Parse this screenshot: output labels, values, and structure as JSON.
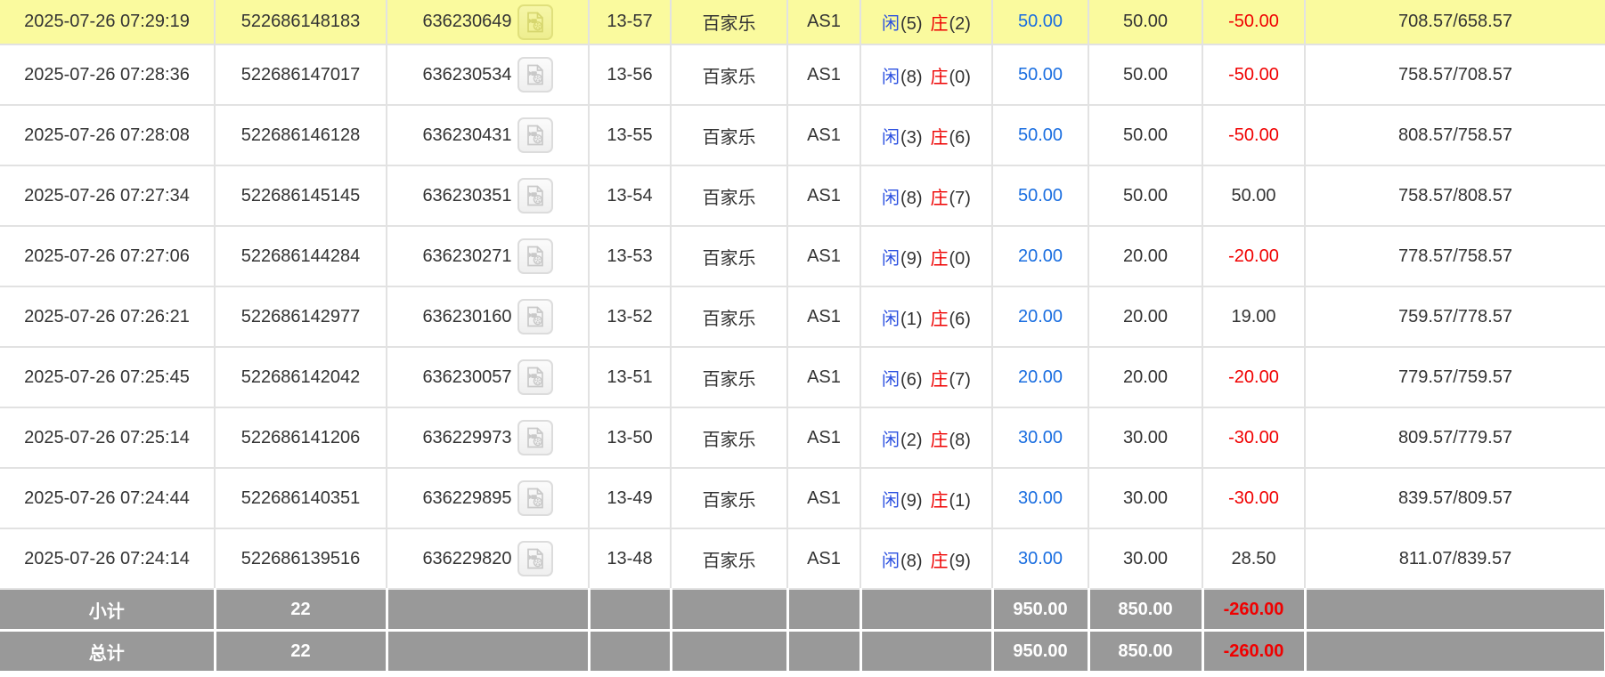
{
  "colors": {
    "highlight_row_bg": "#fafa9e",
    "summary_row_bg": "#999999",
    "grid_border": "#e2e2e2",
    "player_blue": "#2b50e0",
    "bet_amount_blue": "#1a6ee0",
    "banker_red": "#ee0000",
    "loss_red": "#f00000",
    "text": "#333333"
  },
  "icons": {
    "video_replay": "video-file-icon"
  },
  "table": {
    "rows": [
      {
        "time": "2025-07-26 07:29:19",
        "bet_id": "522686148183",
        "game_id": "636230649",
        "round": "13-57",
        "game": "百家乐",
        "table": "AS1",
        "player_label": "闲",
        "player_num": "(5)",
        "banker_label": "庄",
        "banker_num": "(2)",
        "bet": "50.00",
        "valid": "50.00",
        "winloss": "-50.00",
        "balance": "708.57/658.57",
        "highlighted": true
      },
      {
        "time": "2025-07-26 07:28:36",
        "bet_id": "522686147017",
        "game_id": "636230534",
        "round": "13-56",
        "game": "百家乐",
        "table": "AS1",
        "player_label": "闲",
        "player_num": "(8)",
        "banker_label": "庄",
        "banker_num": "(0)",
        "bet": "50.00",
        "valid": "50.00",
        "winloss": "-50.00",
        "balance": "758.57/708.57",
        "highlighted": false
      },
      {
        "time": "2025-07-26 07:28:08",
        "bet_id": "522686146128",
        "game_id": "636230431",
        "round": "13-55",
        "game": "百家乐",
        "table": "AS1",
        "player_label": "闲",
        "player_num": "(3)",
        "banker_label": "庄",
        "banker_num": "(6)",
        "bet": "50.00",
        "valid": "50.00",
        "winloss": "-50.00",
        "balance": "808.57/758.57",
        "highlighted": false
      },
      {
        "time": "2025-07-26 07:27:34",
        "bet_id": "522686145145",
        "game_id": "636230351",
        "round": "13-54",
        "game": "百家乐",
        "table": "AS1",
        "player_label": "闲",
        "player_num": "(8)",
        "banker_label": "庄",
        "banker_num": "(7)",
        "bet": "50.00",
        "valid": "50.00",
        "winloss": "50.00",
        "balance": "758.57/808.57",
        "highlighted": false
      },
      {
        "time": "2025-07-26 07:27:06",
        "bet_id": "522686144284",
        "game_id": "636230271",
        "round": "13-53",
        "game": "百家乐",
        "table": "AS1",
        "player_label": "闲",
        "player_num": "(9)",
        "banker_label": "庄",
        "banker_num": "(0)",
        "bet": "20.00",
        "valid": "20.00",
        "winloss": "-20.00",
        "balance": "778.57/758.57",
        "highlighted": false
      },
      {
        "time": "2025-07-26 07:26:21",
        "bet_id": "522686142977",
        "game_id": "636230160",
        "round": "13-52",
        "game": "百家乐",
        "table": "AS1",
        "player_label": "闲",
        "player_num": "(1)",
        "banker_label": "庄",
        "banker_num": "(6)",
        "bet": "20.00",
        "valid": "20.00",
        "winloss": "19.00",
        "balance": "759.57/778.57",
        "highlighted": false
      },
      {
        "time": "2025-07-26 07:25:45",
        "bet_id": "522686142042",
        "game_id": "636230057",
        "round": "13-51",
        "game": "百家乐",
        "table": "AS1",
        "player_label": "闲",
        "player_num": "(6)",
        "banker_label": "庄",
        "banker_num": "(7)",
        "bet": "20.00",
        "valid": "20.00",
        "winloss": "-20.00",
        "balance": "779.57/759.57",
        "highlighted": false
      },
      {
        "time": "2025-07-26 07:25:14",
        "bet_id": "522686141206",
        "game_id": "636229973",
        "round": "13-50",
        "game": "百家乐",
        "table": "AS1",
        "player_label": "闲",
        "player_num": "(2)",
        "banker_label": "庄",
        "banker_num": "(8)",
        "bet": "30.00",
        "valid": "30.00",
        "winloss": "-30.00",
        "balance": "809.57/779.57",
        "highlighted": false
      },
      {
        "time": "2025-07-26 07:24:44",
        "bet_id": "522686140351",
        "game_id": "636229895",
        "round": "13-49",
        "game": "百家乐",
        "table": "AS1",
        "player_label": "闲",
        "player_num": "(9)",
        "banker_label": "庄",
        "banker_num": "(1)",
        "bet": "30.00",
        "valid": "30.00",
        "winloss": "-30.00",
        "balance": "839.57/809.57",
        "highlighted": false
      },
      {
        "time": "2025-07-26 07:24:14",
        "bet_id": "522686139516",
        "game_id": "636229820",
        "round": "13-48",
        "game": "百家乐",
        "table": "AS1",
        "player_label": "闲",
        "player_num": "(8)",
        "banker_label": "庄",
        "banker_num": "(9)",
        "bet": "30.00",
        "valid": "30.00",
        "winloss": "28.50",
        "balance": "811.07/839.57",
        "highlighted": false
      }
    ],
    "subtotal": {
      "label": "小计",
      "count": "22",
      "bet": "950.00",
      "valid": "850.00",
      "winloss": "-260.00"
    },
    "total": {
      "label": "总计",
      "count": "22",
      "bet": "950.00",
      "valid": "850.00",
      "winloss": "-260.00"
    }
  }
}
